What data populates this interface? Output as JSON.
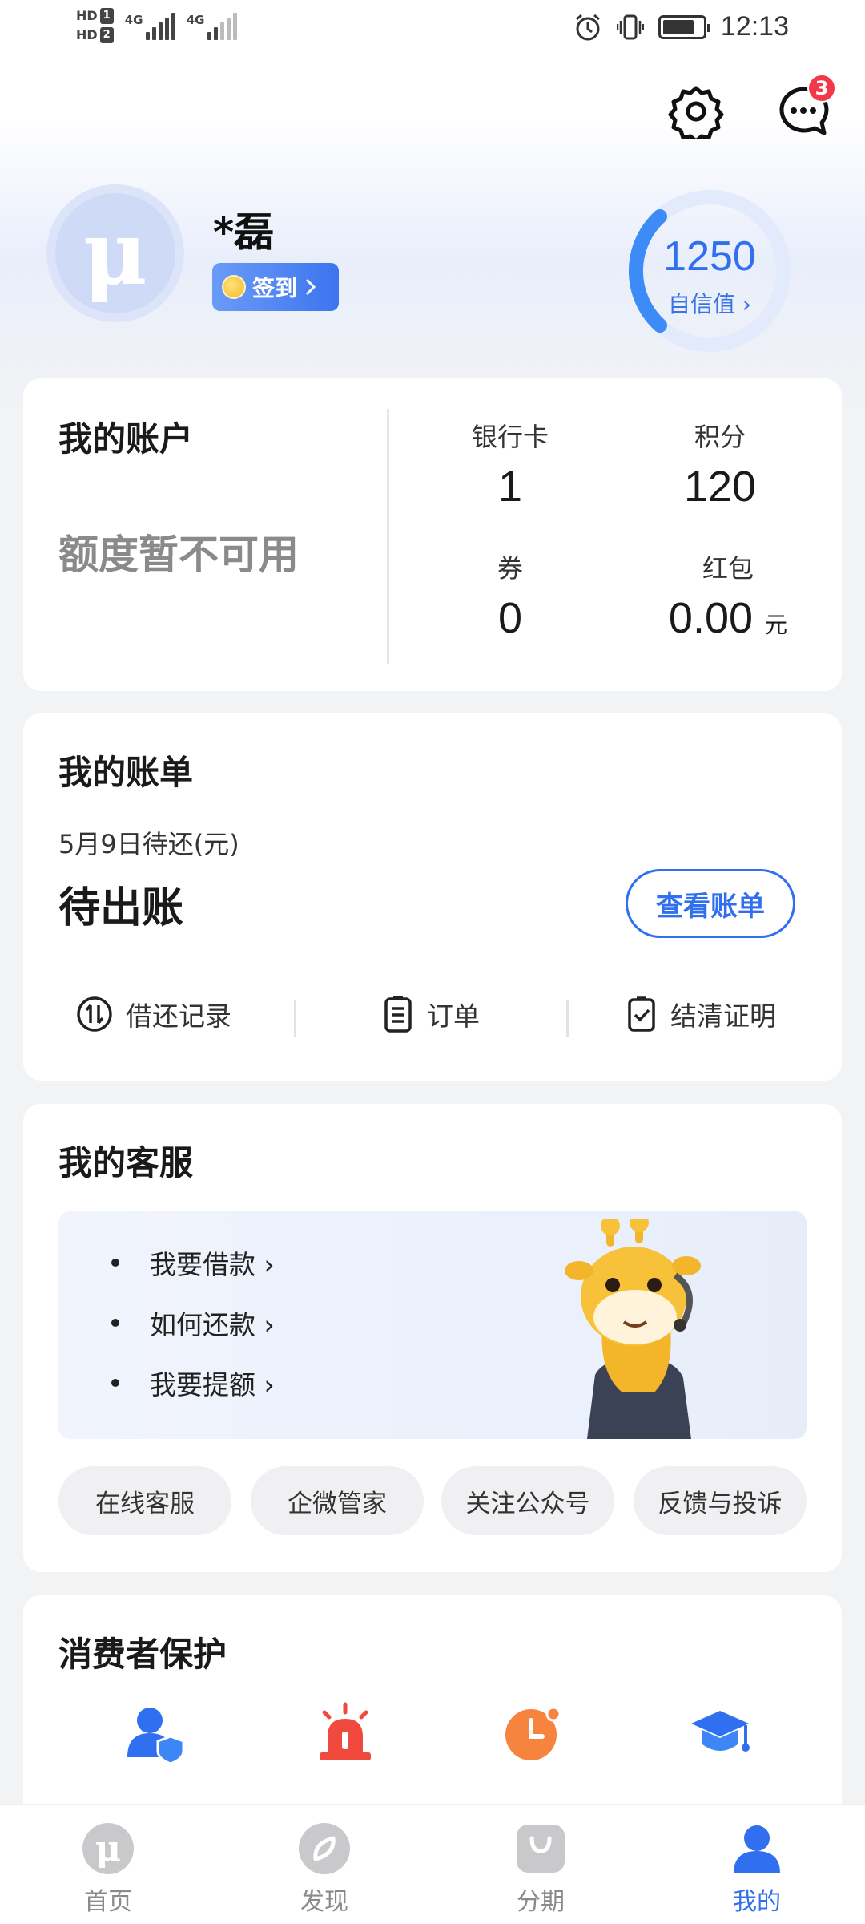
{
  "status_bar": {
    "sim1": "HD",
    "sim1_num": "1",
    "sim2": "HD",
    "sim2_num": "2",
    "net1": "4G",
    "net2": "4G",
    "time": "12:13"
  },
  "header": {
    "messages_badge": "3"
  },
  "profile": {
    "avatar_glyph": "μ",
    "name": "*磊",
    "signin_label": "签到",
    "credit_score": "1250",
    "credit_label": "自信值"
  },
  "account": {
    "title": "我的账户",
    "status": "额度暂不可用",
    "stats": [
      {
        "label": "银行卡",
        "value": "1"
      },
      {
        "label": "积分",
        "value": "120"
      },
      {
        "label": "券",
        "value": "0"
      },
      {
        "label": "红包",
        "value": "0.00",
        "unit": "元"
      }
    ]
  },
  "bill": {
    "title": "我的账单",
    "due_label": "5月9日待还(元)",
    "status": "待出账",
    "view_button": "查看账单",
    "links": [
      "借还记录",
      "订单",
      "结清证明"
    ]
  },
  "service": {
    "title": "我的客服",
    "faq": [
      "我要借款",
      "如何还款",
      "我要提额"
    ],
    "buttons": [
      "在线客服",
      "企微管家",
      "关注公众号",
      "反馈与投诉"
    ]
  },
  "protection": {
    "title": "消费者保护"
  },
  "bottom_nav": {
    "items": [
      {
        "label": "首页",
        "icon": "home-icon"
      },
      {
        "label": "发现",
        "icon": "discover-icon"
      },
      {
        "label": "分期",
        "icon": "installment-icon"
      },
      {
        "label": "我的",
        "icon": "profile-icon"
      }
    ],
    "active_index": 3
  },
  "colors": {
    "accent": "#2f6ff0",
    "badge": "#f2384a",
    "background": "#f2f3f5"
  }
}
